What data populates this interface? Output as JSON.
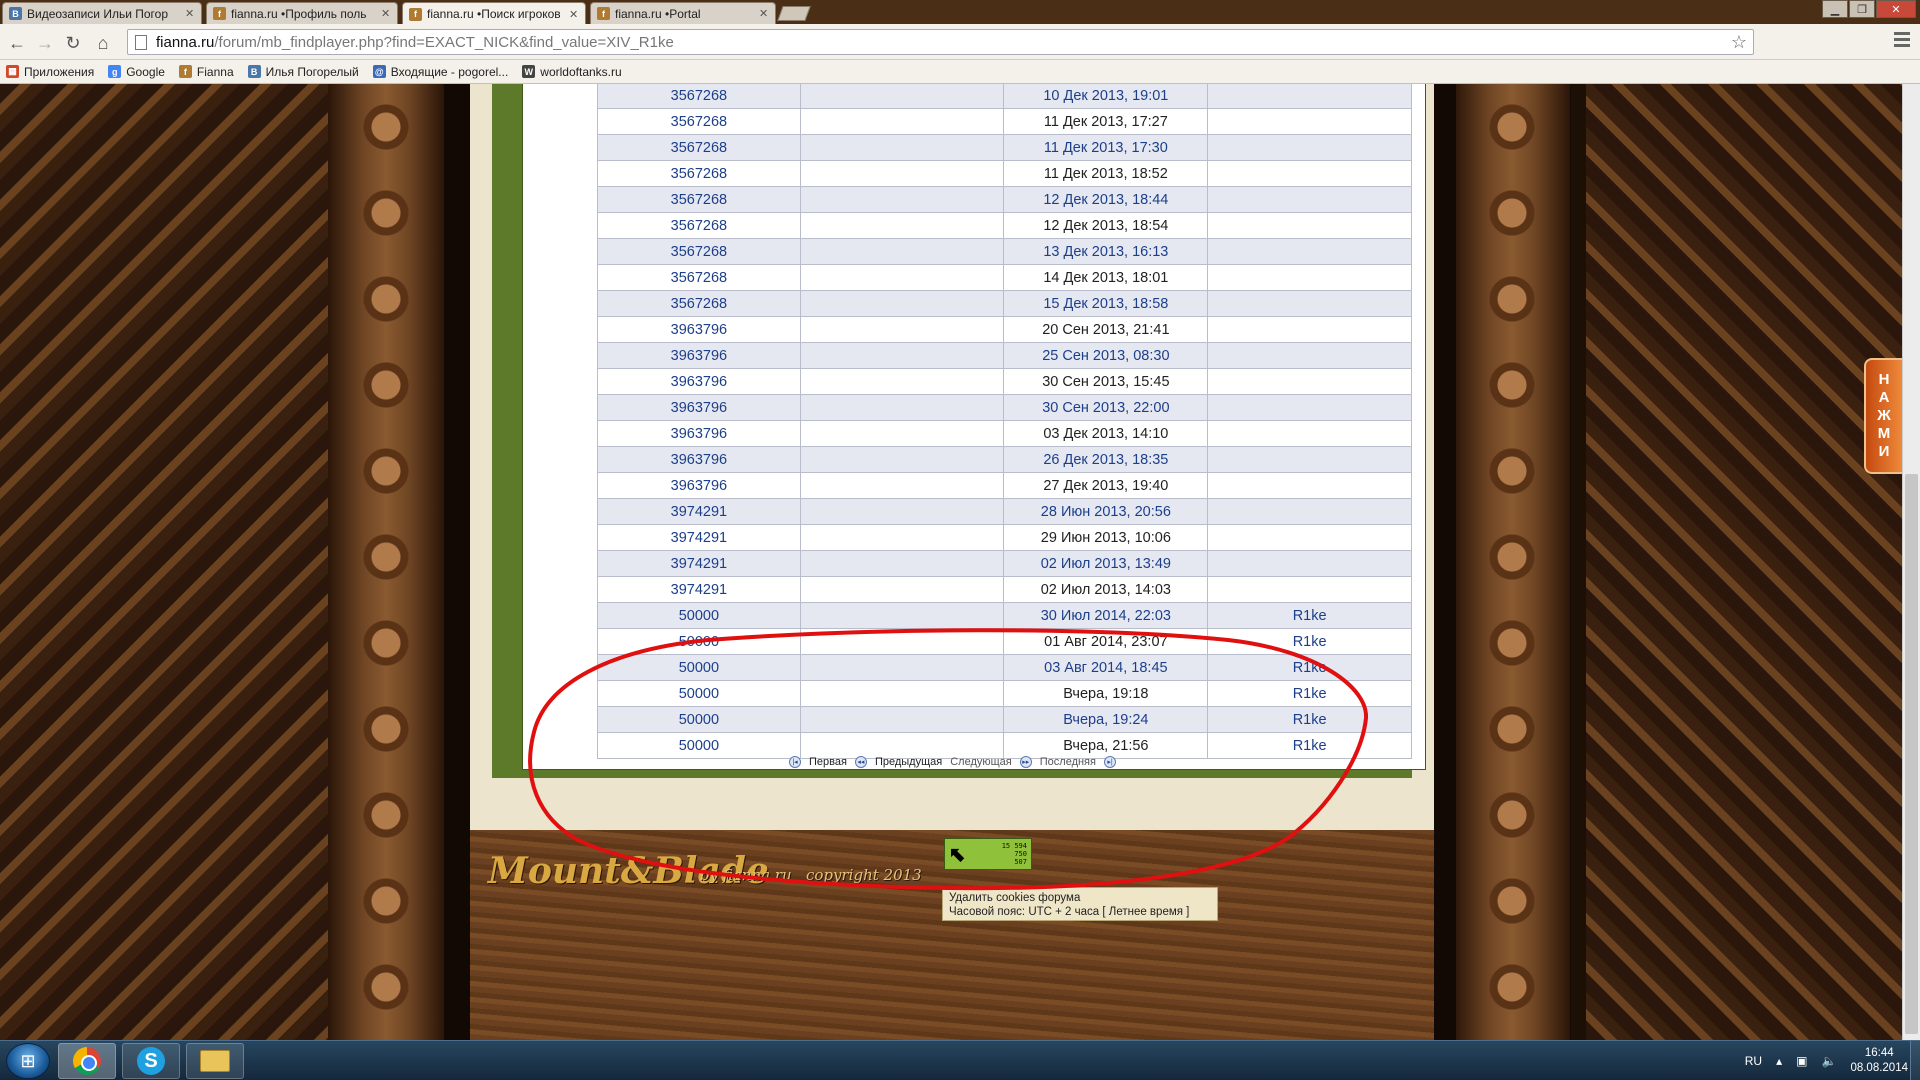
{
  "browser": {
    "tabs": [
      {
        "title": "Видеозаписи Ильи Погор",
        "favicon": "vk-icon",
        "fav_color": "#4a76a8",
        "fav_letter": "B",
        "active": false
      },
      {
        "title": "fianna.ru •Профиль поль",
        "favicon": "fianna-icon",
        "fav_color": "#b07a30",
        "fav_letter": "f",
        "active": false
      },
      {
        "title": "fianna.ru •Поиск игроков",
        "favicon": "fianna-icon",
        "fav_color": "#b07a30",
        "fav_letter": "f",
        "active": true
      },
      {
        "title": "fianna.ru •Portal",
        "favicon": "fianna-icon",
        "fav_color": "#b07a30",
        "fav_letter": "f",
        "active": false
      }
    ],
    "url_host": "fianna.ru",
    "url_path": "/forum/mb_findplayer.php?find=EXACT_NICK&find_value=XIV_R1ke",
    "bookmarks": [
      {
        "label": "Приложения",
        "icon": "apps-icon",
        "color": "#d04a2a",
        "letter": "▦"
      },
      {
        "label": "Google",
        "icon": "google-icon",
        "color": "#4285f4",
        "letter": "g"
      },
      {
        "label": "Fianna",
        "icon": "fianna-icon",
        "color": "#b07a30",
        "letter": "f"
      },
      {
        "label": "Илья Погорелый",
        "icon": "vk-icon",
        "color": "#4a76a8",
        "letter": "B"
      },
      {
        "label": "Входящие - pogorel...",
        "icon": "mail-icon",
        "color": "#3a6ab8",
        "letter": "@"
      },
      {
        "label": "worldoftanks.ru",
        "icon": "wot-icon",
        "color": "#444444",
        "letter": "W"
      }
    ]
  },
  "results": {
    "rows": [
      {
        "id": "3567268",
        "col2": "",
        "date": "10 Дек 2013, 19:01",
        "nick": ""
      },
      {
        "id": "3567268",
        "col2": "",
        "date": "11 Дек 2013, 17:27",
        "nick": ""
      },
      {
        "id": "3567268",
        "col2": "",
        "date": "11 Дек 2013, 17:30",
        "nick": ""
      },
      {
        "id": "3567268",
        "col2": "",
        "date": "11 Дек 2013, 18:52",
        "nick": ""
      },
      {
        "id": "3567268",
        "col2": "",
        "date": "12 Дек 2013, 18:44",
        "nick": ""
      },
      {
        "id": "3567268",
        "col2": "",
        "date": "12 Дек 2013, 18:54",
        "nick": ""
      },
      {
        "id": "3567268",
        "col2": "",
        "date": "13 Дек 2013, 16:13",
        "nick": ""
      },
      {
        "id": "3567268",
        "col2": "",
        "date": "14 Дек 2013, 18:01",
        "nick": ""
      },
      {
        "id": "3567268",
        "col2": "",
        "date": "15 Дек 2013, 18:58",
        "nick": ""
      },
      {
        "id": "3963796",
        "col2": "",
        "date": "20 Сен 2013, 21:41",
        "nick": ""
      },
      {
        "id": "3963796",
        "col2": "",
        "date": "25 Сен 2013, 08:30",
        "nick": ""
      },
      {
        "id": "3963796",
        "col2": "",
        "date": "30 Сен 2013, 15:45",
        "nick": ""
      },
      {
        "id": "3963796",
        "col2": "",
        "date": "30 Сен 2013, 22:00",
        "nick": ""
      },
      {
        "id": "3963796",
        "col2": "",
        "date": "03 Дек 2013, 14:10",
        "nick": ""
      },
      {
        "id": "3963796",
        "col2": "",
        "date": "26 Дек 2013, 18:35",
        "nick": ""
      },
      {
        "id": "3963796",
        "col2": "",
        "date": "27 Дек 2013, 19:40",
        "nick": ""
      },
      {
        "id": "3974291",
        "col2": "",
        "date": "28 Июн 2013, 20:56",
        "nick": ""
      },
      {
        "id": "3974291",
        "col2": "",
        "date": "29 Июн 2013, 10:06",
        "nick": ""
      },
      {
        "id": "3974291",
        "col2": "",
        "date": "02 Июл 2013, 13:49",
        "nick": ""
      },
      {
        "id": "3974291",
        "col2": "",
        "date": "02 Июл 2013, 14:03",
        "nick": ""
      },
      {
        "id": "50000",
        "col2": "",
        "date": "30 Июл 2014, 22:03",
        "nick": "R1ke"
      },
      {
        "id": "50000",
        "col2": "",
        "date": "01 Авг 2014, 23:07",
        "nick": "R1ke"
      },
      {
        "id": "50000",
        "col2": "",
        "date": "03 Авг 2014, 18:45",
        "nick": "R1ke"
      },
      {
        "id": "50000",
        "col2": "",
        "date": "Вчера, 19:18",
        "nick": "R1ke"
      },
      {
        "id": "50000",
        "col2": "",
        "date": "Вчера, 19:24",
        "nick": "R1ke"
      },
      {
        "id": "50000",
        "col2": "",
        "date": "Вчера, 21:56",
        "nick": "R1ke"
      }
    ]
  },
  "pager": {
    "first": "Первая",
    "prev": "Предыдущая",
    "next": "Следующая",
    "last": "Последняя"
  },
  "footer": {
    "logo": "Mount&Blade",
    "by": "by fianna.ru",
    "copyright": "copyright 2013",
    "counter_lines": [
      "15 594",
      "750",
      "507"
    ],
    "cookie_link": "Удалить cookies форума",
    "timezone": "Часовой пояс: UTC + 2 часа [ Летнее время ]"
  },
  "sidetab": {
    "letters": [
      "Н",
      "А",
      "Ж",
      "М",
      "И"
    ]
  },
  "taskbar": {
    "lang": "RU",
    "time": "16:44",
    "date": "08.08.2014"
  },
  "colors": {
    "annotation_red": "#e01010",
    "link_blue": "#1c3f8a",
    "frame_green": "#5d7a2b"
  }
}
